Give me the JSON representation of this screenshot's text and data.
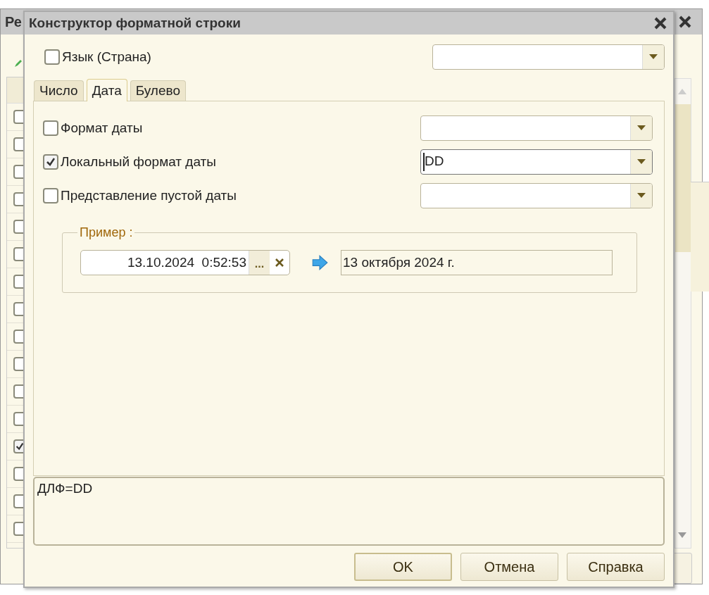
{
  "background_window": {
    "title": "Ре",
    "rows": [
      {
        "checked": false
      },
      {
        "checked": false
      },
      {
        "checked": false
      },
      {
        "checked": false
      },
      {
        "checked": false
      },
      {
        "checked": false
      },
      {
        "checked": false
      },
      {
        "checked": false
      },
      {
        "checked": false
      },
      {
        "checked": false
      },
      {
        "checked": false
      },
      {
        "checked": false
      },
      {
        "checked": true
      },
      {
        "checked": false
      },
      {
        "checked": false
      },
      {
        "checked": false
      }
    ]
  },
  "dialog": {
    "title": "Конструктор форматной строки",
    "language": {
      "label": "Язык (Страна)",
      "checked": false
    },
    "tabs": [
      {
        "label": "Число",
        "selected": false
      },
      {
        "label": "Дата",
        "selected": true
      },
      {
        "label": "Булево",
        "selected": false
      }
    ],
    "options": [
      {
        "label": "Формат даты",
        "checked": false
      },
      {
        "label": "Локальный формат даты",
        "checked": true,
        "value": "DD"
      },
      {
        "label": "Представление пустой даты",
        "checked": false
      }
    ],
    "example": {
      "legend": "Пример :",
      "input": "13.10.2024  0:52:53",
      "choose": "...",
      "result": "13 октября 2024 г."
    },
    "format_string": "ДЛФ=DD",
    "buttons": [
      {
        "label": "OK",
        "default": true
      },
      {
        "label": "Отмена",
        "default": false
      },
      {
        "label": "Справка",
        "default": false
      }
    ]
  }
}
